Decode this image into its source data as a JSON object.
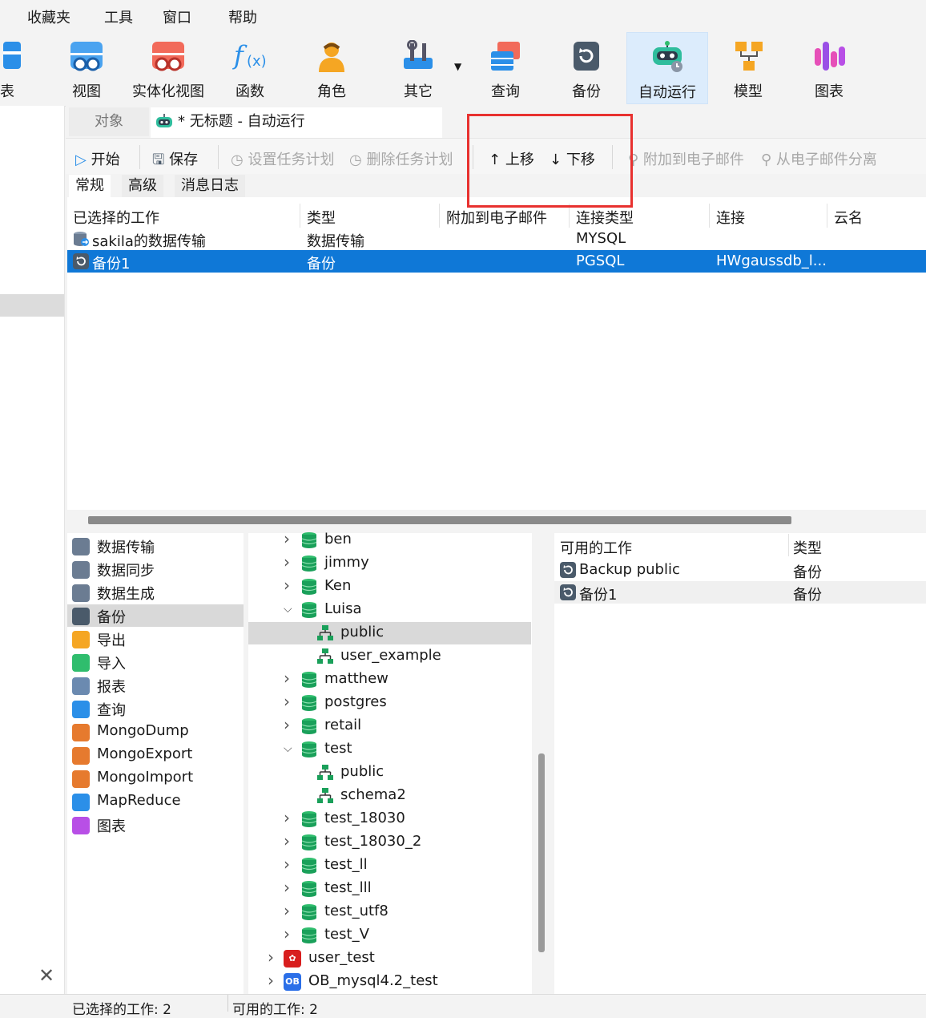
{
  "menu": [
    "收藏夹",
    "工具",
    "窗口",
    "帮助"
  ],
  "ribbon": {
    "partial": "表",
    "buttons": [
      "视图",
      "实体化视图",
      "函数",
      "角色",
      "其它",
      "查询",
      "备份",
      "自动运行",
      "模型",
      "图表"
    ]
  },
  "tabs": {
    "objects": "对象",
    "autorun": "* 无标题 - 自动运行"
  },
  "toolbar": {
    "start": "开始",
    "save": "保存",
    "set_schedule": "设置任务计划",
    "delete_schedule": "删除任务计划",
    "move_up": "上移",
    "move_down": "下移",
    "attach_email": "附加到电子邮件",
    "detach_email": "从电子邮件分离"
  },
  "subtabs": [
    "常规",
    "高级",
    "消息日志"
  ],
  "job_table": {
    "headers": [
      "已选择的工作",
      "类型",
      "附加到电子邮件",
      "连接类型",
      "连接",
      "云名"
    ],
    "rows": [
      {
        "name": "sakila的数据传输",
        "type": "数据传输",
        "attach": "",
        "conn_type": "MYSQL",
        "conn": "",
        "cloud": ""
      },
      {
        "name": "备份1",
        "type": "备份",
        "attach": "",
        "conn_type": "PGSQL",
        "conn": "HWgaussdb_l...",
        "cloud": ""
      }
    ]
  },
  "job_types": [
    "数据传输",
    "数据同步",
    "数据生成",
    "备份",
    "导出",
    "导入",
    "报表",
    "查询",
    "MongoDump",
    "MongoExport",
    "MongoImport",
    "MapReduce",
    "图表"
  ],
  "tree": {
    "top": [
      "ben",
      "jimmy",
      "Ken",
      "Luisa"
    ],
    "luisa_schemas": [
      "public",
      "user_example"
    ],
    "middle": [
      "matthew",
      "postgres",
      "retail",
      "test"
    ],
    "test_schemas": [
      "public",
      "schema2"
    ],
    "bottom": [
      "test_18030",
      "test_18030_2",
      "test_ll",
      "test_lll",
      "test_utf8",
      "test_V"
    ],
    "connections": [
      "user_test",
      "OB_mysql4.2_test"
    ],
    "ob_badge": "OB"
  },
  "available": {
    "headers": [
      "可用的工作",
      "类型"
    ],
    "rows": [
      {
        "name": "Backup public",
        "type": "备份"
      },
      {
        "name": "备份1",
        "type": "备份"
      }
    ]
  },
  "status": {
    "selected": "已选择的工作: 2",
    "available": "可用的工作: 2"
  },
  "colors": {
    "selection": "#0f78d7",
    "highlight": "#e8312f",
    "db_green": "#1aa05a"
  }
}
